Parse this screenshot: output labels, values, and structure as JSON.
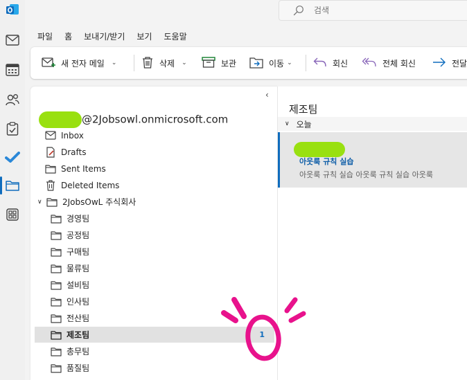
{
  "search": {
    "placeholder": "검색"
  },
  "menu": {
    "tabs": [
      {
        "label": "파일"
      },
      {
        "label": "홈",
        "active": true
      },
      {
        "label": "보내기/받기"
      },
      {
        "label": "보기"
      },
      {
        "label": "도움말"
      }
    ]
  },
  "ribbon": {
    "new_mail": "새 전자 메일",
    "delete": "삭제",
    "archive": "보관",
    "move": "이동",
    "reply": "회신",
    "reply_all": "전체 회신",
    "forward": "전달"
  },
  "folders": {
    "account": "@2Jobsowl.onmicrosoft.com",
    "items": [
      {
        "label": "Inbox",
        "icon": "inbox-icon"
      },
      {
        "label": "Drafts",
        "icon": "drafts-icon"
      },
      {
        "label": "Sent Items",
        "icon": "folder-icon"
      },
      {
        "label": "Deleted Items",
        "icon": "trash-icon"
      },
      {
        "label": "2JobsOwL 주식회사",
        "icon": "folder-icon",
        "expanded": true
      },
      {
        "label": "경영팀",
        "icon": "folder-icon"
      },
      {
        "label": "공정팀",
        "icon": "folder-icon"
      },
      {
        "label": "구매팀",
        "icon": "folder-icon"
      },
      {
        "label": "물류팀",
        "icon": "folder-icon"
      },
      {
        "label": "설비팀",
        "icon": "folder-icon"
      },
      {
        "label": "인사팀",
        "icon": "folder-icon"
      },
      {
        "label": "전산팀",
        "icon": "folder-icon"
      },
      {
        "label": "제조팀",
        "icon": "folder-icon",
        "selected": true,
        "unread": "1"
      },
      {
        "label": "총무팀",
        "icon": "folder-icon"
      },
      {
        "label": "품질팀",
        "icon": "folder-icon"
      }
    ]
  },
  "message_list": {
    "title": "제조팀",
    "group": "오늘",
    "messages": [
      {
        "subject": "아웃룩 규칙 실습",
        "preview": "아웃룩 규칙 실습   아웃룩 규칙 실습   아웃룩"
      }
    ]
  },
  "colors": {
    "accent": "#0f6cbd",
    "highlighter": "#99e010",
    "annotation": "#e8128c"
  }
}
